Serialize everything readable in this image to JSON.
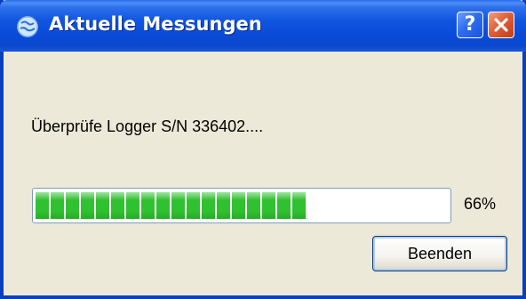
{
  "window": {
    "title": "Aktuelle Messungen",
    "title_icon": "globe-icon",
    "help_icon": "help-icon",
    "help_label": "?",
    "close_icon": "close-icon"
  },
  "dialog": {
    "message": "Überprüfe Logger S/N 336402....",
    "progress_percent": 66,
    "progress_label": "66%",
    "cancel_label": "Beenden"
  },
  "colors": {
    "titlebar": "#0a4ad6",
    "progress_fill": "#2fc12f",
    "close_button": "#e0603a",
    "background": "#ece9d8"
  }
}
